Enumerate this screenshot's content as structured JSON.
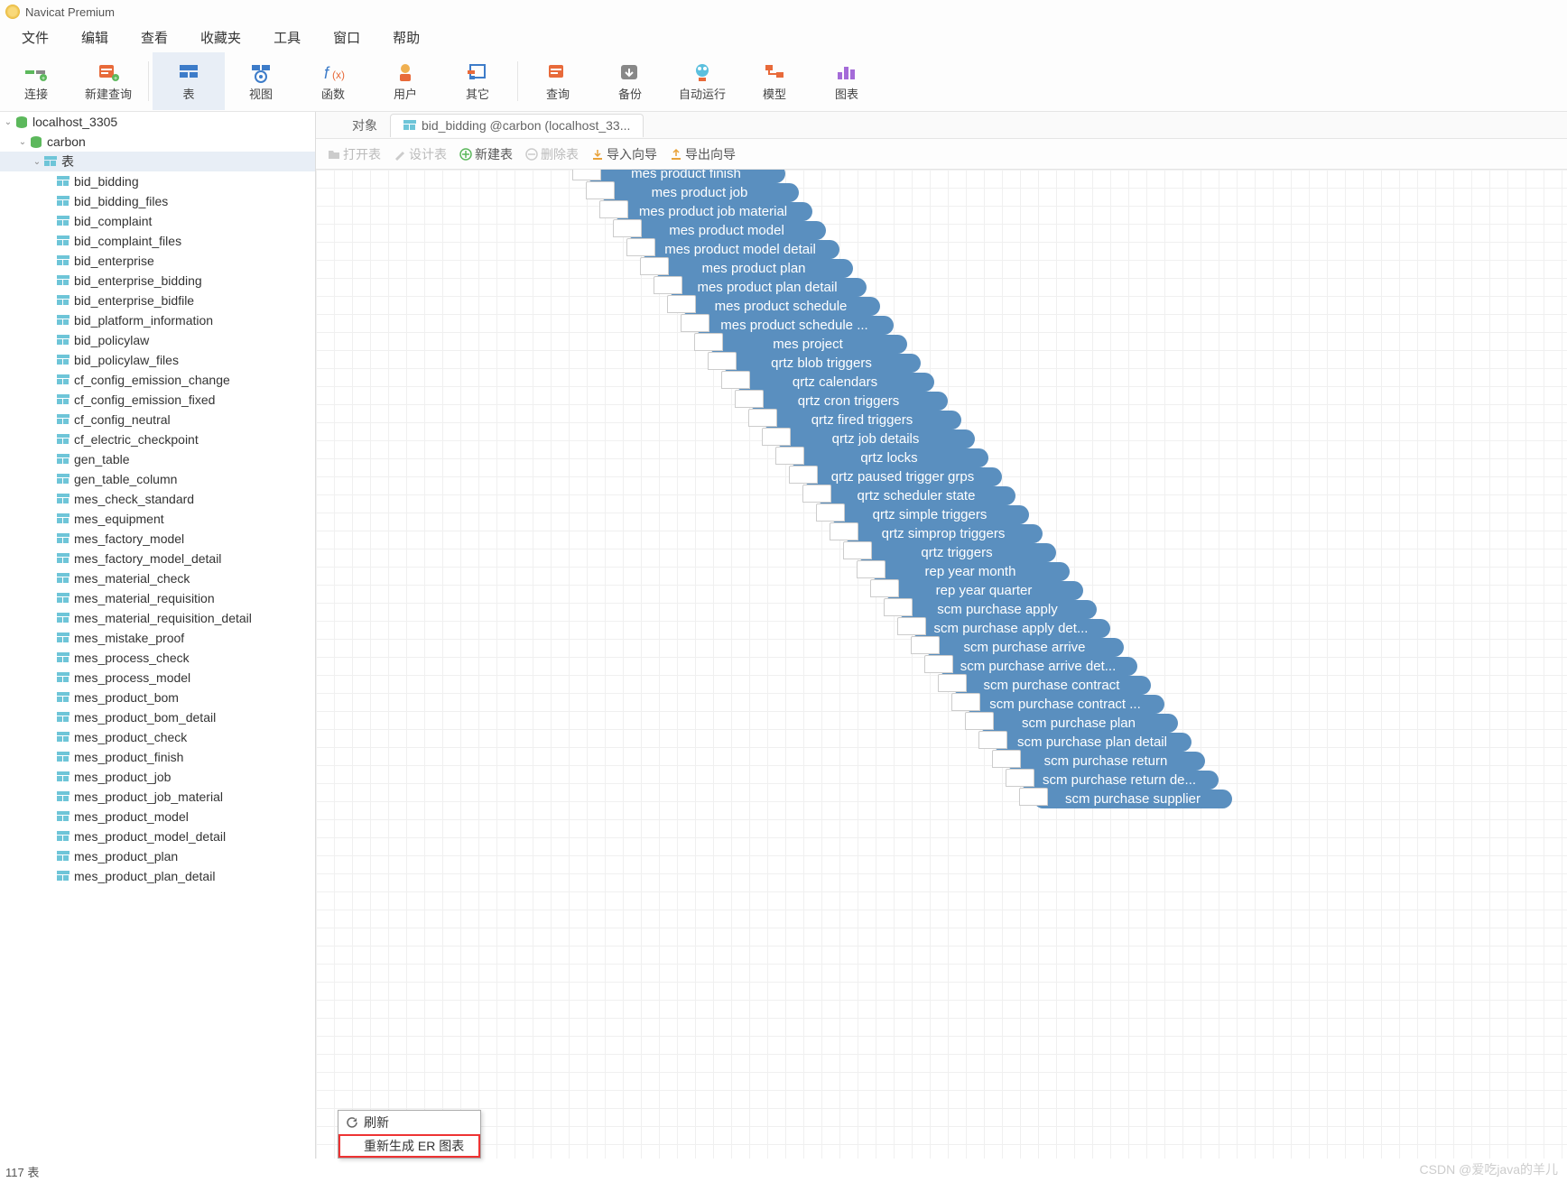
{
  "title": "Navicat Premium",
  "menu": [
    "文件",
    "编辑",
    "查看",
    "收藏夹",
    "工具",
    "窗口",
    "帮助"
  ],
  "toolbar": [
    {
      "label": "连接",
      "id": "connect"
    },
    {
      "label": "新建查询",
      "id": "new-query"
    },
    {
      "label": "表",
      "id": "table",
      "active": true
    },
    {
      "label": "视图",
      "id": "view"
    },
    {
      "label": "函数",
      "id": "fx"
    },
    {
      "label": "用户",
      "id": "user"
    },
    {
      "label": "其它",
      "id": "other"
    },
    {
      "label": "查询",
      "id": "query"
    },
    {
      "label": "备份",
      "id": "backup"
    },
    {
      "label": "自动运行",
      "id": "auto"
    },
    {
      "label": "模型",
      "id": "model"
    },
    {
      "label": "图表",
      "id": "chart"
    }
  ],
  "tree": {
    "conn": "localhost_3305",
    "db": "carbon",
    "folder": "表",
    "tables": [
      "bid_bidding",
      "bid_bidding_files",
      "bid_complaint",
      "bid_complaint_files",
      "bid_enterprise",
      "bid_enterprise_bidding",
      "bid_enterprise_bidfile",
      "bid_platform_information",
      "bid_policylaw",
      "bid_policylaw_files",
      "cf_config_emission_change",
      "cf_config_emission_fixed",
      "cf_config_neutral",
      "cf_electric_checkpoint",
      "gen_table",
      "gen_table_column",
      "mes_check_standard",
      "mes_equipment",
      "mes_factory_model",
      "mes_factory_model_detail",
      "mes_material_check",
      "mes_material_requisition",
      "mes_material_requisition_detail",
      "mes_mistake_proof",
      "mes_process_check",
      "mes_process_model",
      "mes_product_bom",
      "mes_product_bom_detail",
      "mes_product_check",
      "mes_product_finish",
      "mes_product_job",
      "mes_product_job_material",
      "mes_product_model",
      "mes_product_model_detail",
      "mes_product_plan",
      "mes_product_plan_detail"
    ]
  },
  "tabs": {
    "obj": "对象",
    "open": "bid_bidding @carbon (localhost_33..."
  },
  "subtool": {
    "open": "打开表",
    "design": "设计表",
    "new": "新建表",
    "delete": "删除表",
    "import": "导入向导",
    "export": "导出向导"
  },
  "er_nodes": [
    "mes product finish",
    "mes product job",
    "mes product job material",
    "mes product model",
    "mes product model detail",
    "mes product plan",
    "mes product plan detail",
    "mes product schedule",
    "mes product schedule ...",
    "mes project",
    "qrtz blob triggers",
    "qrtz calendars",
    "qrtz cron triggers",
    "qrtz fired triggers",
    "qrtz job details",
    "qrtz locks",
    "qrtz paused trigger grps",
    "qrtz scheduler state",
    "qrtz simple triggers",
    "qrtz simprop triggers",
    "qrtz triggers",
    "rep year month",
    "rep year quarter",
    "scm purchase apply",
    "scm purchase apply det...",
    "scm purchase arrive",
    "scm purchase arrive det...",
    "scm purchase contract",
    "scm purchase contract ...",
    "scm purchase plan",
    "scm purchase plan detail",
    "scm purchase return",
    "scm purchase return de...",
    "scm purchase supplier"
  ],
  "ctx": {
    "refresh": "刷新",
    "regen": "重新生成 ER 图表"
  },
  "status": {
    "count": "117 表"
  },
  "watermark": "CSDN @爱吃java的羊儿"
}
